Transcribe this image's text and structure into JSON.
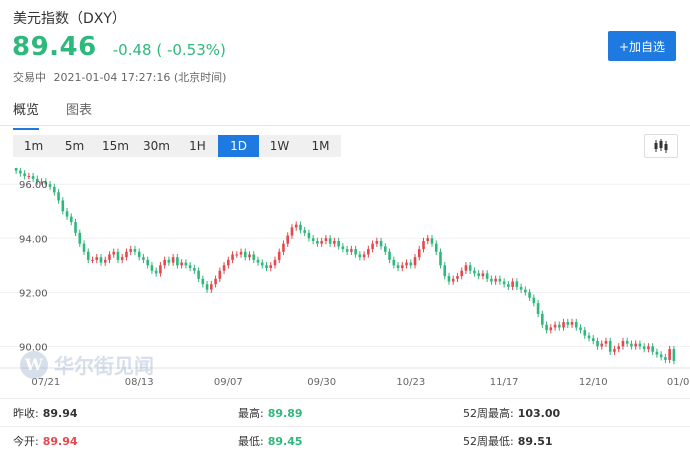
{
  "header": {
    "title": "美元指数（DXY）",
    "price": "89.46",
    "change": "-0.48 ( -0.53%)",
    "status": "交易中",
    "datetime": "2021-01-04 17:27:16 (北京时间)",
    "add_button": "+加自选"
  },
  "tabs": [
    {
      "label": "概览"
    },
    {
      "label": "图表"
    }
  ],
  "periods": [
    {
      "label": "1m"
    },
    {
      "label": "5m"
    },
    {
      "label": "15m"
    },
    {
      "label": "30m"
    },
    {
      "label": "1H"
    },
    {
      "label": "1D"
    },
    {
      "label": "1W"
    },
    {
      "label": "1M"
    }
  ],
  "active_period": "1D",
  "watermark": {
    "text": "华尔街见闻"
  },
  "colors": {
    "up": "#e5484d",
    "down": "#2db87c",
    "accent": "#1e7ae0"
  },
  "stats": {
    "prev_close": {
      "label": "昨收:",
      "value": "89.94"
    },
    "open": {
      "label": "今开:",
      "value": "89.94"
    },
    "high": {
      "label": "最高:",
      "value": "89.89"
    },
    "low": {
      "label": "最低:",
      "value": "89.45"
    },
    "high52": {
      "label": "52周最高:",
      "value": "103.00"
    },
    "low52": {
      "label": "52周最低:",
      "value": "89.51"
    }
  },
  "chart_data": {
    "type": "candlestick",
    "title": "",
    "xlabel": "",
    "ylabel": "",
    "ylim": [
      89.2,
      96.6
    ],
    "y_ticks": [
      "96.00",
      "94.00",
      "92.00",
      "90.00"
    ],
    "y_tick_values": [
      96,
      94,
      92,
      90
    ],
    "x_ticks": [
      "07/21",
      "08/13",
      "09/07",
      "09/30",
      "10/23",
      "11/17",
      "12/10",
      "01/0"
    ],
    "x_tick_index": [
      7,
      29,
      50,
      72,
      93,
      115,
      136,
      156
    ],
    "grid": true,
    "close": [
      96.5,
      96.4,
      96.3,
      96.3,
      96.2,
      96.1,
      96.1,
      96.0,
      95.9,
      95.7,
      95.4,
      95.0,
      94.8,
      94.6,
      94.2,
      93.8,
      93.5,
      93.2,
      93.2,
      93.3,
      93.1,
      93.2,
      93.4,
      93.5,
      93.2,
      93.3,
      93.5,
      93.6,
      93.5,
      93.3,
      93.2,
      93.0,
      92.8,
      92.7,
      93.0,
      93.2,
      93.1,
      93.3,
      93.0,
      93.1,
      93.0,
      92.9,
      92.8,
      92.5,
      92.3,
      92.1,
      92.3,
      92.5,
      92.8,
      93.0,
      93.2,
      93.4,
      93.4,
      93.5,
      93.3,
      93.4,
      93.2,
      93.1,
      93.0,
      92.9,
      93.0,
      93.2,
      93.5,
      93.8,
      94.1,
      94.4,
      94.5,
      94.3,
      94.2,
      94.0,
      93.9,
      93.8,
      93.9,
      94.0,
      93.8,
      93.9,
      93.7,
      93.6,
      93.5,
      93.6,
      93.4,
      93.3,
      93.4,
      93.6,
      93.8,
      93.9,
      93.7,
      93.5,
      93.2,
      93.0,
      92.9,
      93.0,
      93.1,
      93.0,
      93.3,
      93.6,
      93.9,
      94.0,
      93.8,
      93.5,
      93.0,
      92.6,
      92.4,
      92.5,
      92.6,
      92.8,
      93.0,
      92.8,
      92.7,
      92.6,
      92.7,
      92.5,
      92.4,
      92.5,
      92.4,
      92.3,
      92.2,
      92.4,
      92.2,
      92.1,
      92.0,
      91.8,
      91.6,
      91.2,
      90.8,
      90.6,
      90.7,
      90.8,
      90.7,
      90.9,
      90.8,
      90.9,
      90.7,
      90.6,
      90.4,
      90.3,
      90.2,
      90.0,
      90.1,
      90.2,
      89.8,
      89.9,
      90.0,
      90.2,
      90.1,
      90.0,
      90.1,
      90.0,
      89.9,
      90.0,
      89.8,
      89.7,
      89.6,
      89.5,
      89.9,
      89.46
    ]
  }
}
